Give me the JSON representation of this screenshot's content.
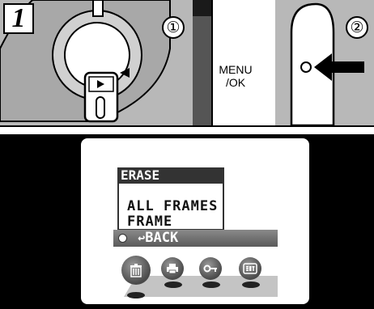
{
  "step": {
    "number": "1"
  },
  "panel1": {
    "marker": "①"
  },
  "panel2": {
    "menu_label_line1": "MENU",
    "menu_label_line2": "/OK"
  },
  "panel3": {
    "marker": "②"
  },
  "lcd": {
    "menu_title": "ERASE",
    "options": [
      "ALL FRAMES",
      "FRAME"
    ],
    "back_label": "BACK",
    "icons": [
      {
        "name": "erase-icon",
        "selected": true
      },
      {
        "name": "print-order-icon",
        "selected": false
      },
      {
        "name": "protect-key-icon",
        "selected": false
      },
      {
        "name": "set-icon",
        "selected": false
      }
    ]
  }
}
